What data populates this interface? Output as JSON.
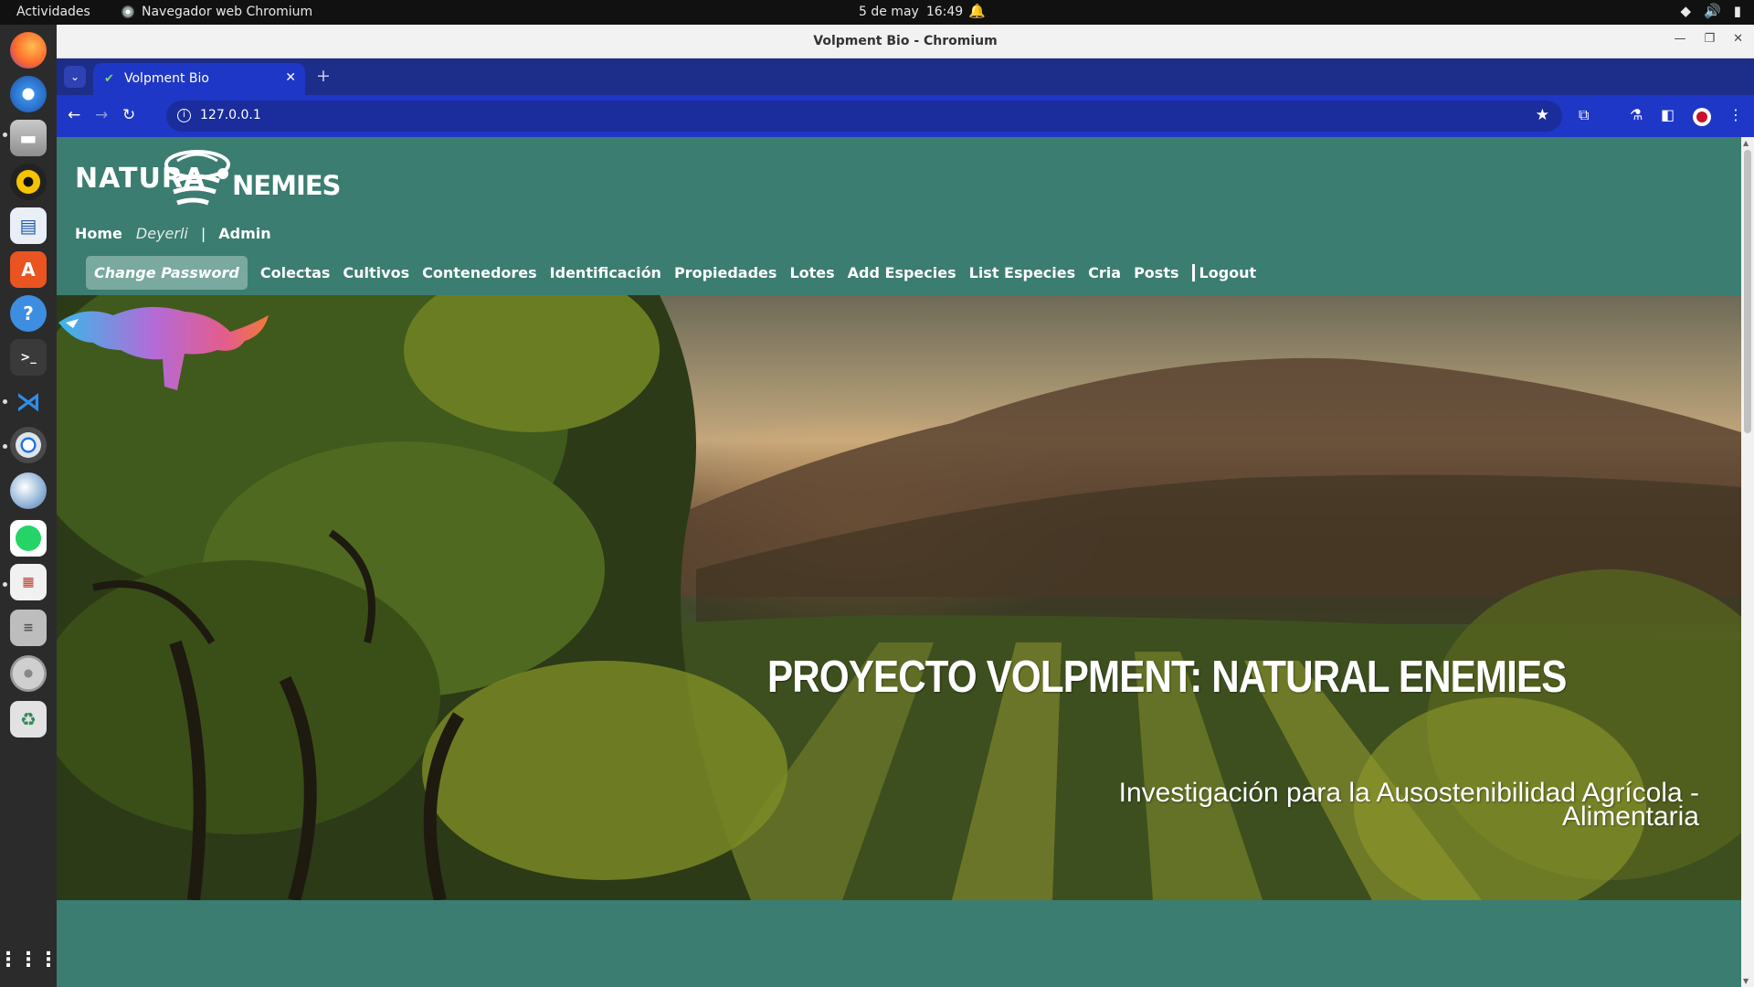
{
  "system": {
    "activities": "Actividades",
    "app_name": "Navegador web Chromium",
    "date": "5 de may",
    "time": "16:49"
  },
  "window": {
    "title": "Volpment Bio - Chromium"
  },
  "tab": {
    "label": "Volpment Bio"
  },
  "address_bar": {
    "url": "127.0.0.1"
  },
  "site": {
    "logo_word1": "NATURA",
    "logo_word2": "NEMIES",
    "user_nav": {
      "home": "Home",
      "user": "Deyerli",
      "separator": "|",
      "admin": "Admin"
    },
    "main_nav": {
      "change_password": "Change Password",
      "items": [
        "Colectas",
        "Cultivos",
        "Contenedores",
        "Identificación",
        "Propiedades",
        "Lotes",
        "Add Especies",
        "List Especies",
        "Cria",
        "Posts"
      ],
      "logout": "Logout"
    },
    "hero": {
      "title": "PROYECTO VOLPMENT: NATURAL ENEMIES",
      "subtitle": "Investigación para la Ausostenibilidad Agrícola - Alimentaria"
    }
  },
  "colors": {
    "page_bg": "#3b7d71",
    "browser_tab_strip": "#1c2d8a",
    "browser_toolbar": "#1f37c6",
    "nav_pill": "#7aa9a0"
  },
  "dock_icons": [
    "firefox-icon",
    "thunderbird-icon",
    "files-icon",
    "rhythmbox-icon",
    "writer-icon",
    "app-center-icon",
    "help-icon",
    "terminal-icon",
    "vscode-icon",
    "chromium-icon",
    "eagle-icon",
    "whatsapp-icon",
    "document-viewer-icon",
    "text-editor-icon",
    "disk-icon",
    "trash-icon",
    "app-grid-icon"
  ]
}
